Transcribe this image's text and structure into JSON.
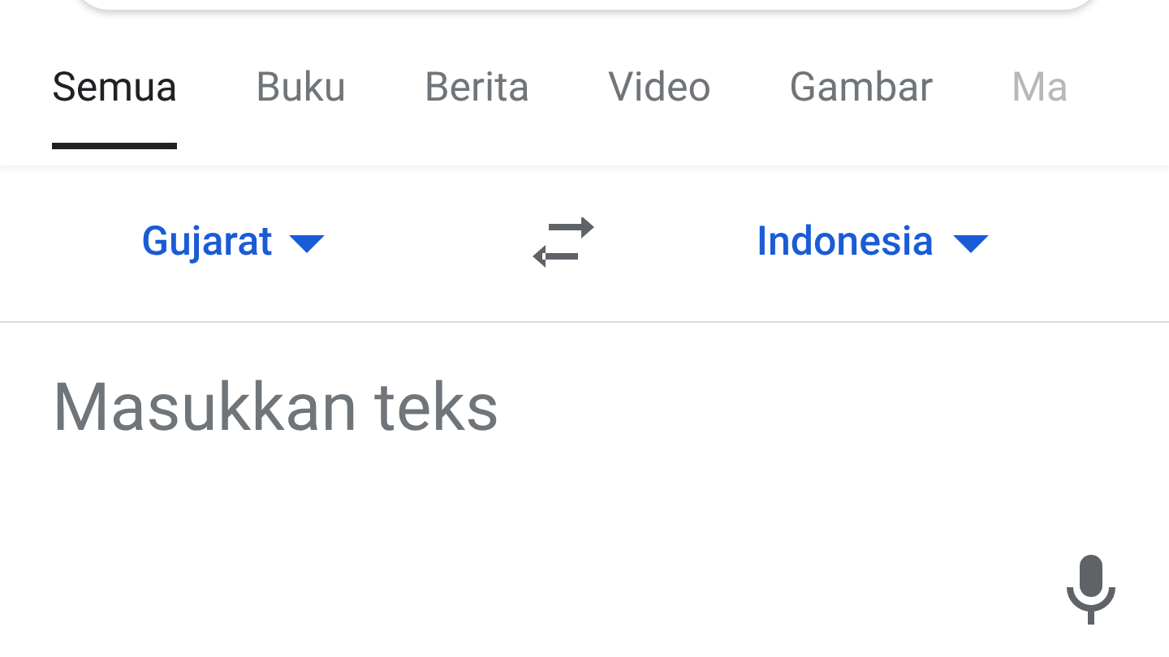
{
  "tabs": [
    {
      "label": "Semua",
      "selected": true
    },
    {
      "label": "Buku",
      "selected": false
    },
    {
      "label": "Berita",
      "selected": false
    },
    {
      "label": "Video",
      "selected": false
    },
    {
      "label": "Gambar",
      "selected": false
    },
    {
      "label": "Ma",
      "selected": false
    }
  ],
  "translator": {
    "source_language": "Gujarat",
    "target_language": "Indonesia",
    "input": {
      "placeholder": "Masukkan teks"
    }
  }
}
